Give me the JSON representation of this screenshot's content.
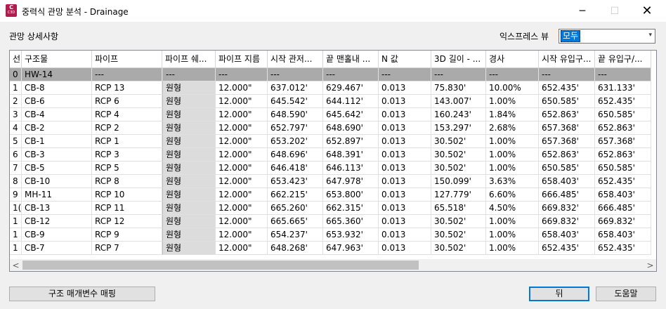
{
  "window": {
    "title": "중력식 관망 분석 - Drainage",
    "icon_letter": "C",
    "icon_sub": "C3D",
    "minimize_glyph": "─",
    "maximize_glyph": "☐",
    "close_glyph": "✕"
  },
  "section": {
    "label": "관망 상세사항"
  },
  "express_view": {
    "label": "익스프레스 뷰",
    "selected": "모두",
    "chevron": "▾"
  },
  "columns": [
    "선",
    "구조물",
    "파이프",
    "파이프 쉐...",
    "파이프 지름",
    "시작 관저...",
    "끝 맨홀내 ...",
    "N 값",
    "3D 길이 - ...",
    "경사",
    "시작 유입구...",
    "끝 유입구/..."
  ],
  "rows": [
    [
      "0",
      "HW-14",
      "---",
      "---",
      "---",
      "---",
      "---",
      "---",
      "---",
      "---",
      "---",
      "---"
    ],
    [
      "1",
      "CB-8",
      "RCP 13",
      "원형",
      "12.000\"",
      "637.012'",
      "629.467'",
      "0.013",
      "75.830'",
      "10.00%",
      "652.435'",
      "631.133'"
    ],
    [
      "2",
      "CB-6",
      "RCP 6",
      "원형",
      "12.000\"",
      "645.542'",
      "644.112'",
      "0.013",
      "143.007'",
      "1.00%",
      "650.585'",
      "652.435'"
    ],
    [
      "3",
      "CB-4",
      "RCP 4",
      "원형",
      "12.000\"",
      "648.590'",
      "645.642'",
      "0.013",
      "160.243'",
      "1.84%",
      "652.863'",
      "650.585'"
    ],
    [
      "4",
      "CB-2",
      "RCP 2",
      "원형",
      "12.000\"",
      "652.797'",
      "648.690'",
      "0.013",
      "153.297'",
      "2.68%",
      "657.368'",
      "652.863'"
    ],
    [
      "5",
      "CB-1",
      "RCP 1",
      "원형",
      "12.000\"",
      "653.202'",
      "652.897'",
      "0.013",
      "30.502'",
      "1.00%",
      "657.368'",
      "657.368'"
    ],
    [
      "6",
      "CB-3",
      "RCP 3",
      "원형",
      "12.000\"",
      "648.696'",
      "648.391'",
      "0.013",
      "30.502'",
      "1.00%",
      "652.863'",
      "652.863'"
    ],
    [
      "7",
      "CB-5",
      "RCP 5",
      "원형",
      "12.000\"",
      "646.418'",
      "646.113'",
      "0.013",
      "30.502'",
      "1.00%",
      "650.585'",
      "650.585'"
    ],
    [
      "8",
      "CB-10",
      "RCP 8",
      "원형",
      "12.000\"",
      "653.423'",
      "647.978'",
      "0.013",
      "150.099'",
      "3.63%",
      "658.403'",
      "652.435'"
    ],
    [
      "9",
      "MH-11",
      "RCP 10",
      "원형",
      "12.000\"",
      "662.215'",
      "653.800'",
      "0.013",
      "127.779'",
      "6.60%",
      "666.485'",
      "658.403'"
    ],
    [
      "1(",
      "CB-13",
      "RCP 11",
      "원형",
      "12.000\"",
      "665.260'",
      "662.315'",
      "0.013",
      "65.518'",
      "4.50%",
      "669.832'",
      "666.485'"
    ],
    [
      "1",
      "CB-12",
      "RCP 12",
      "원형",
      "12.000\"",
      "665.665'",
      "665.360'",
      "0.013",
      "30.502'",
      "1.00%",
      "669.832'",
      "669.832'"
    ],
    [
      "1",
      "CB-9",
      "RCP 9",
      "원형",
      "12.000\"",
      "654.237'",
      "653.932'",
      "0.013",
      "30.502'",
      "1.00%",
      "658.403'",
      "658.403'"
    ],
    [
      "1",
      "CB-7",
      "RCP 7",
      "원형",
      "12.000\"",
      "648.268'",
      "647.963'",
      "0.013",
      "30.502'",
      "1.00%",
      "652.435'",
      "652.435'"
    ]
  ],
  "selected_row": 0,
  "scroll": {
    "left_arrow": "<",
    "right_arrow": ">"
  },
  "buttons": {
    "map_params": "구조 매개변수 매핑",
    "back": "뒤",
    "help": "도움말"
  }
}
